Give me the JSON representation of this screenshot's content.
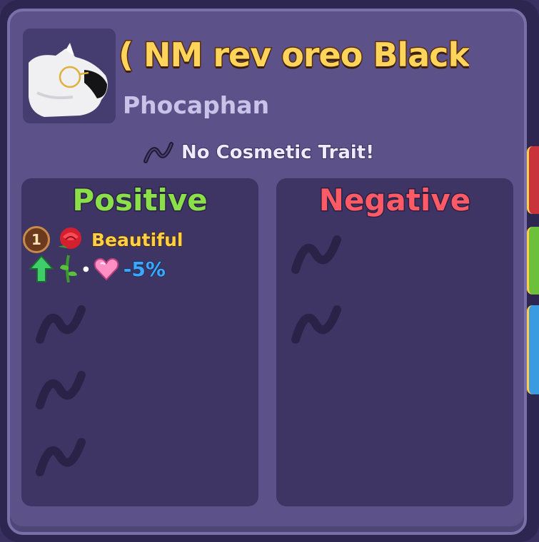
{
  "pet": {
    "name": "( NM rev oreo Black",
    "species": "Phocaphan",
    "image_icon": "pet-portrait-icon"
  },
  "cosmetic": {
    "text": "No Cosmetic Trait!",
    "icon": "dna-icon"
  },
  "positive": {
    "heading": "Positive",
    "trait": {
      "level": "1",
      "name": "Beautiful",
      "value": "-5%",
      "icons": [
        "rose-icon",
        "green-arrow-up-icon",
        "rose-stem-icon",
        "heart-gem-icon"
      ]
    },
    "empty_slots": 3
  },
  "negative": {
    "heading": "Negative",
    "empty_slots": 2
  },
  "colors": {
    "panel": "#5c5289",
    "column": "#3e3565",
    "title": "#ffd45a",
    "positive": "#8be04a",
    "negative": "#ff5a66",
    "value": "#3aa8ff"
  }
}
